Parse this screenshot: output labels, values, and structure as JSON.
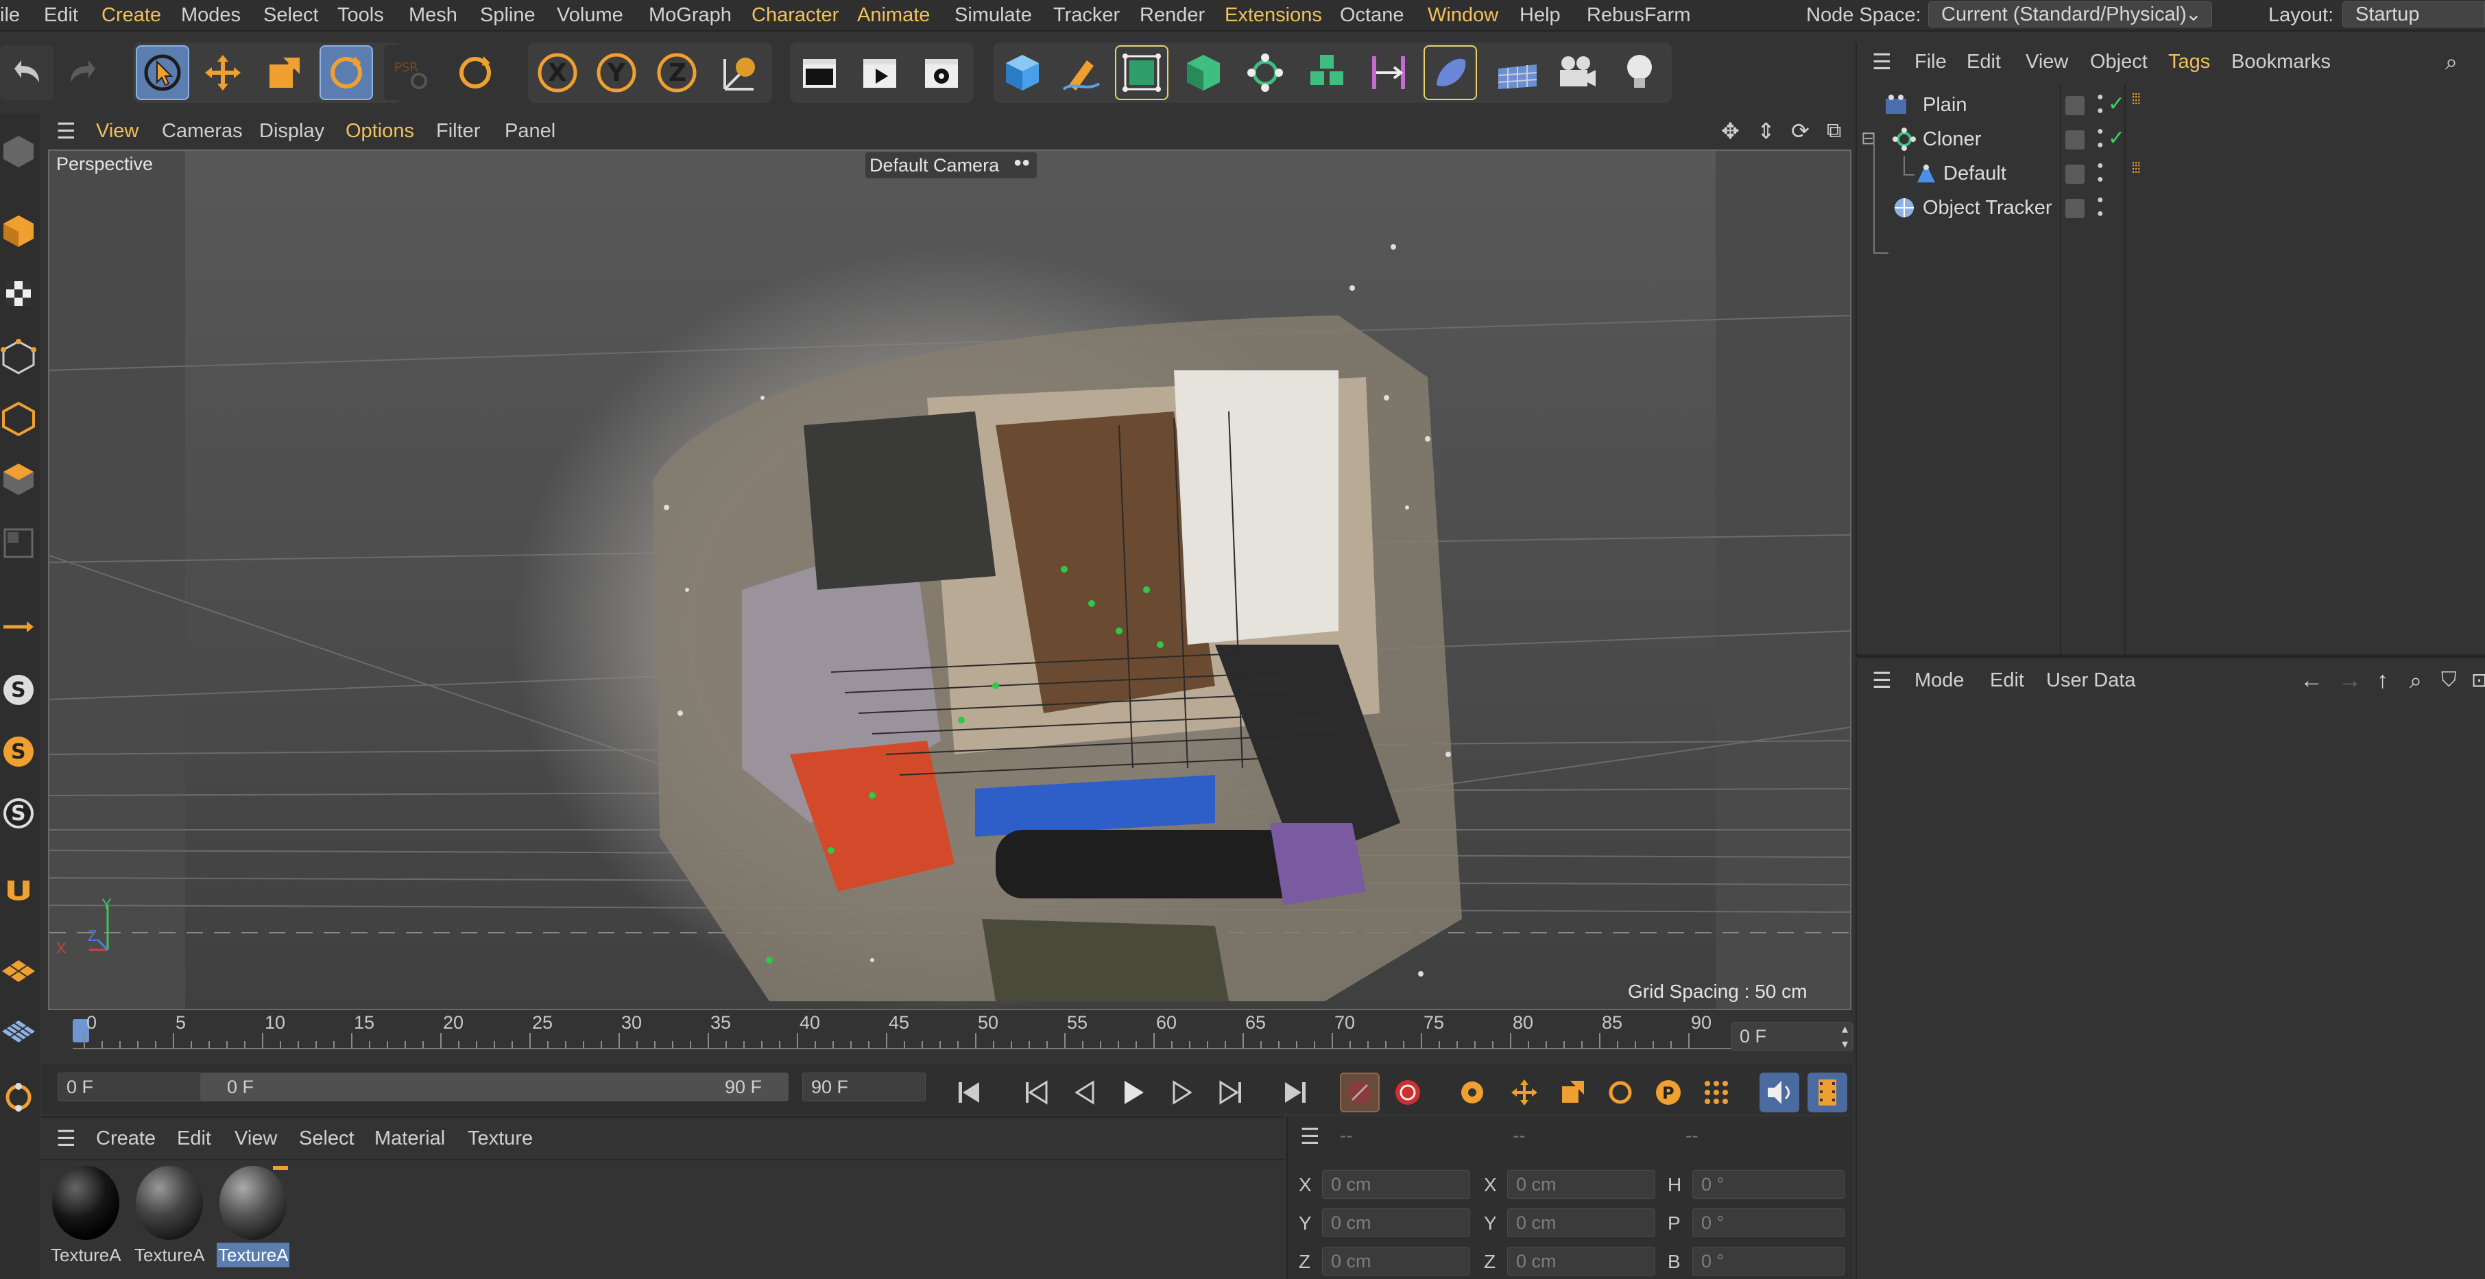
{
  "menu_bar": {
    "items": [
      "ile",
      "Edit",
      "Create",
      "Modes",
      "Select",
      "Tools",
      "Mesh",
      "Spline",
      "Volume",
      "MoGraph",
      "Character",
      "Animate",
      "Simulate",
      "Tracker",
      "Render",
      "Extensions",
      "Octane",
      "Window",
      "Help",
      "RebusFarm"
    ],
    "highlighted": [
      "Create",
      "Character",
      "Animate",
      "Extensions",
      "Window"
    ],
    "node_space_label": "Node Space:",
    "node_space_value": "Current (Standard/Physical)",
    "layout_label": "Layout:",
    "layout_value": "Startup"
  },
  "viewport": {
    "menu": [
      "View",
      "Cameras",
      "Display",
      "Options",
      "Filter",
      "Panel"
    ],
    "highlighted": [
      "View",
      "Options"
    ],
    "view_name": "Perspective",
    "camera_name": "Default Camera",
    "grid_spacing": "Grid Spacing : 50 cm",
    "axis_labels": {
      "y": "Y",
      "x": "X",
      "z": "Z"
    }
  },
  "timeline": {
    "ticks": [
      "0",
      "5",
      "10",
      "15",
      "20",
      "25",
      "30",
      "35",
      "40",
      "45",
      "50",
      "55",
      "60",
      "65",
      "70",
      "75",
      "80",
      "85",
      "90"
    ],
    "current_frame_field": "0 F"
  },
  "transport": {
    "start_field": "0 F",
    "range_start": "0 F",
    "range_end": "90 F",
    "end_field": "90 F"
  },
  "material_manager": {
    "menu": [
      "Create",
      "Edit",
      "View",
      "Select",
      "Material",
      "Texture"
    ],
    "materials": [
      {
        "name": "TextureA"
      },
      {
        "name": "TextureA"
      },
      {
        "name": "TextureA"
      }
    ]
  },
  "coordinate_manager": {
    "headers": [
      "--",
      "--",
      "--"
    ],
    "rows": [
      {
        "a_label": "X",
        "a_value": "0 cm",
        "b_label": "X",
        "b_value": "0 cm",
        "c_label": "H",
        "c_value": "0 °"
      },
      {
        "a_label": "Y",
        "a_value": "0 cm",
        "b_label": "Y",
        "b_value": "0 cm",
        "c_label": "P",
        "c_value": "0 °"
      },
      {
        "a_label": "Z",
        "a_value": "0 cm",
        "b_label": "Z",
        "b_value": "0 cm",
        "c_label": "B",
        "c_value": "0 °"
      }
    ]
  },
  "object_manager": {
    "menu": [
      "File",
      "Edit",
      "View",
      "Object",
      "Tags",
      "Bookmarks"
    ],
    "highlighted": [
      "Tags"
    ],
    "objects": [
      {
        "name": "Plain"
      },
      {
        "name": "Cloner"
      },
      {
        "name": "Default"
      },
      {
        "name": "Object Tracker"
      }
    ]
  },
  "attribute_manager": {
    "menu": [
      "Mode",
      "Edit",
      "User Data"
    ]
  },
  "colors": {
    "accent_yellow": "#f2c15a",
    "selection_blue": "#5b7db0",
    "background": "#333333",
    "viewport": "#4a4a4a"
  }
}
